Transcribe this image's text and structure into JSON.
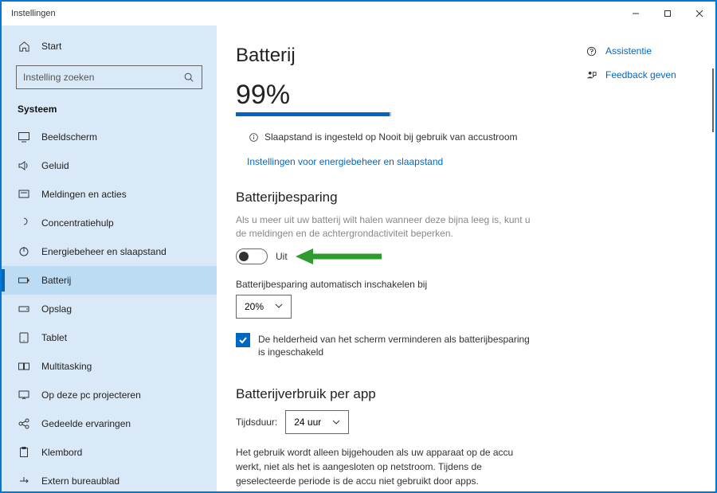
{
  "window": {
    "title": "Instellingen"
  },
  "sidebar": {
    "home_label": "Start",
    "search_placeholder": "Instelling zoeken",
    "section_title": "Systeem",
    "items": [
      {
        "label": "Beeldscherm",
        "icon": "display-icon"
      },
      {
        "label": "Geluid",
        "icon": "sound-icon"
      },
      {
        "label": "Meldingen en acties",
        "icon": "notifications-icon"
      },
      {
        "label": "Concentratiehulp",
        "icon": "focus-assist-icon"
      },
      {
        "label": "Energiebeheer en slaapstand",
        "icon": "power-icon"
      },
      {
        "label": "Batterij",
        "icon": "battery-icon",
        "active": true
      },
      {
        "label": "Opslag",
        "icon": "storage-icon"
      },
      {
        "label": "Tablet",
        "icon": "tablet-icon"
      },
      {
        "label": "Multitasking",
        "icon": "multitasking-icon"
      },
      {
        "label": "Op deze pc projecteren",
        "icon": "projecting-icon"
      },
      {
        "label": "Gedeelde ervaringen",
        "icon": "shared-icon"
      },
      {
        "label": "Klembord",
        "icon": "clipboard-icon"
      },
      {
        "label": "Extern bureaublad",
        "icon": "remote-desktop-icon"
      }
    ]
  },
  "main": {
    "title": "Batterij",
    "percent_text": "99%",
    "percent_value": 99,
    "sleep_info": "Slaapstand is ingesteld op Nooit bij gebruik van accustroom",
    "power_sleep_link": "Instellingen voor energiebeheer en slaapstand",
    "saver_heading": "Batterijbesparing",
    "saver_desc": "Als u meer uit uw batterij wilt halen wanneer deze bijna leeg is, kunt u de meldingen en de achtergrondactiviteit beperken.",
    "toggle_state_label": "Uit",
    "toggle_on": false,
    "auto_enable_label": "Batterijbesparing automatisch inschakelen bij",
    "auto_enable_value": "20%",
    "lower_brightness_label": "De helderheid van het scherm verminderen als batterijbesparing is ingeschakeld",
    "lower_brightness_checked": true,
    "usage_heading": "Batterijverbruik per app",
    "time_label": "Tijdsduur:",
    "time_value": "24 uur",
    "usage_note": "Het gebruik wordt alleen bijgehouden als uw apparaat op de accu werkt, niet als het is aangesloten op netstroom. Tijdens de geselecteerde periode is de accu niet gebruikt door apps."
  },
  "side_panel": {
    "help_label": "Assistentie",
    "feedback_label": "Feedback geven"
  }
}
